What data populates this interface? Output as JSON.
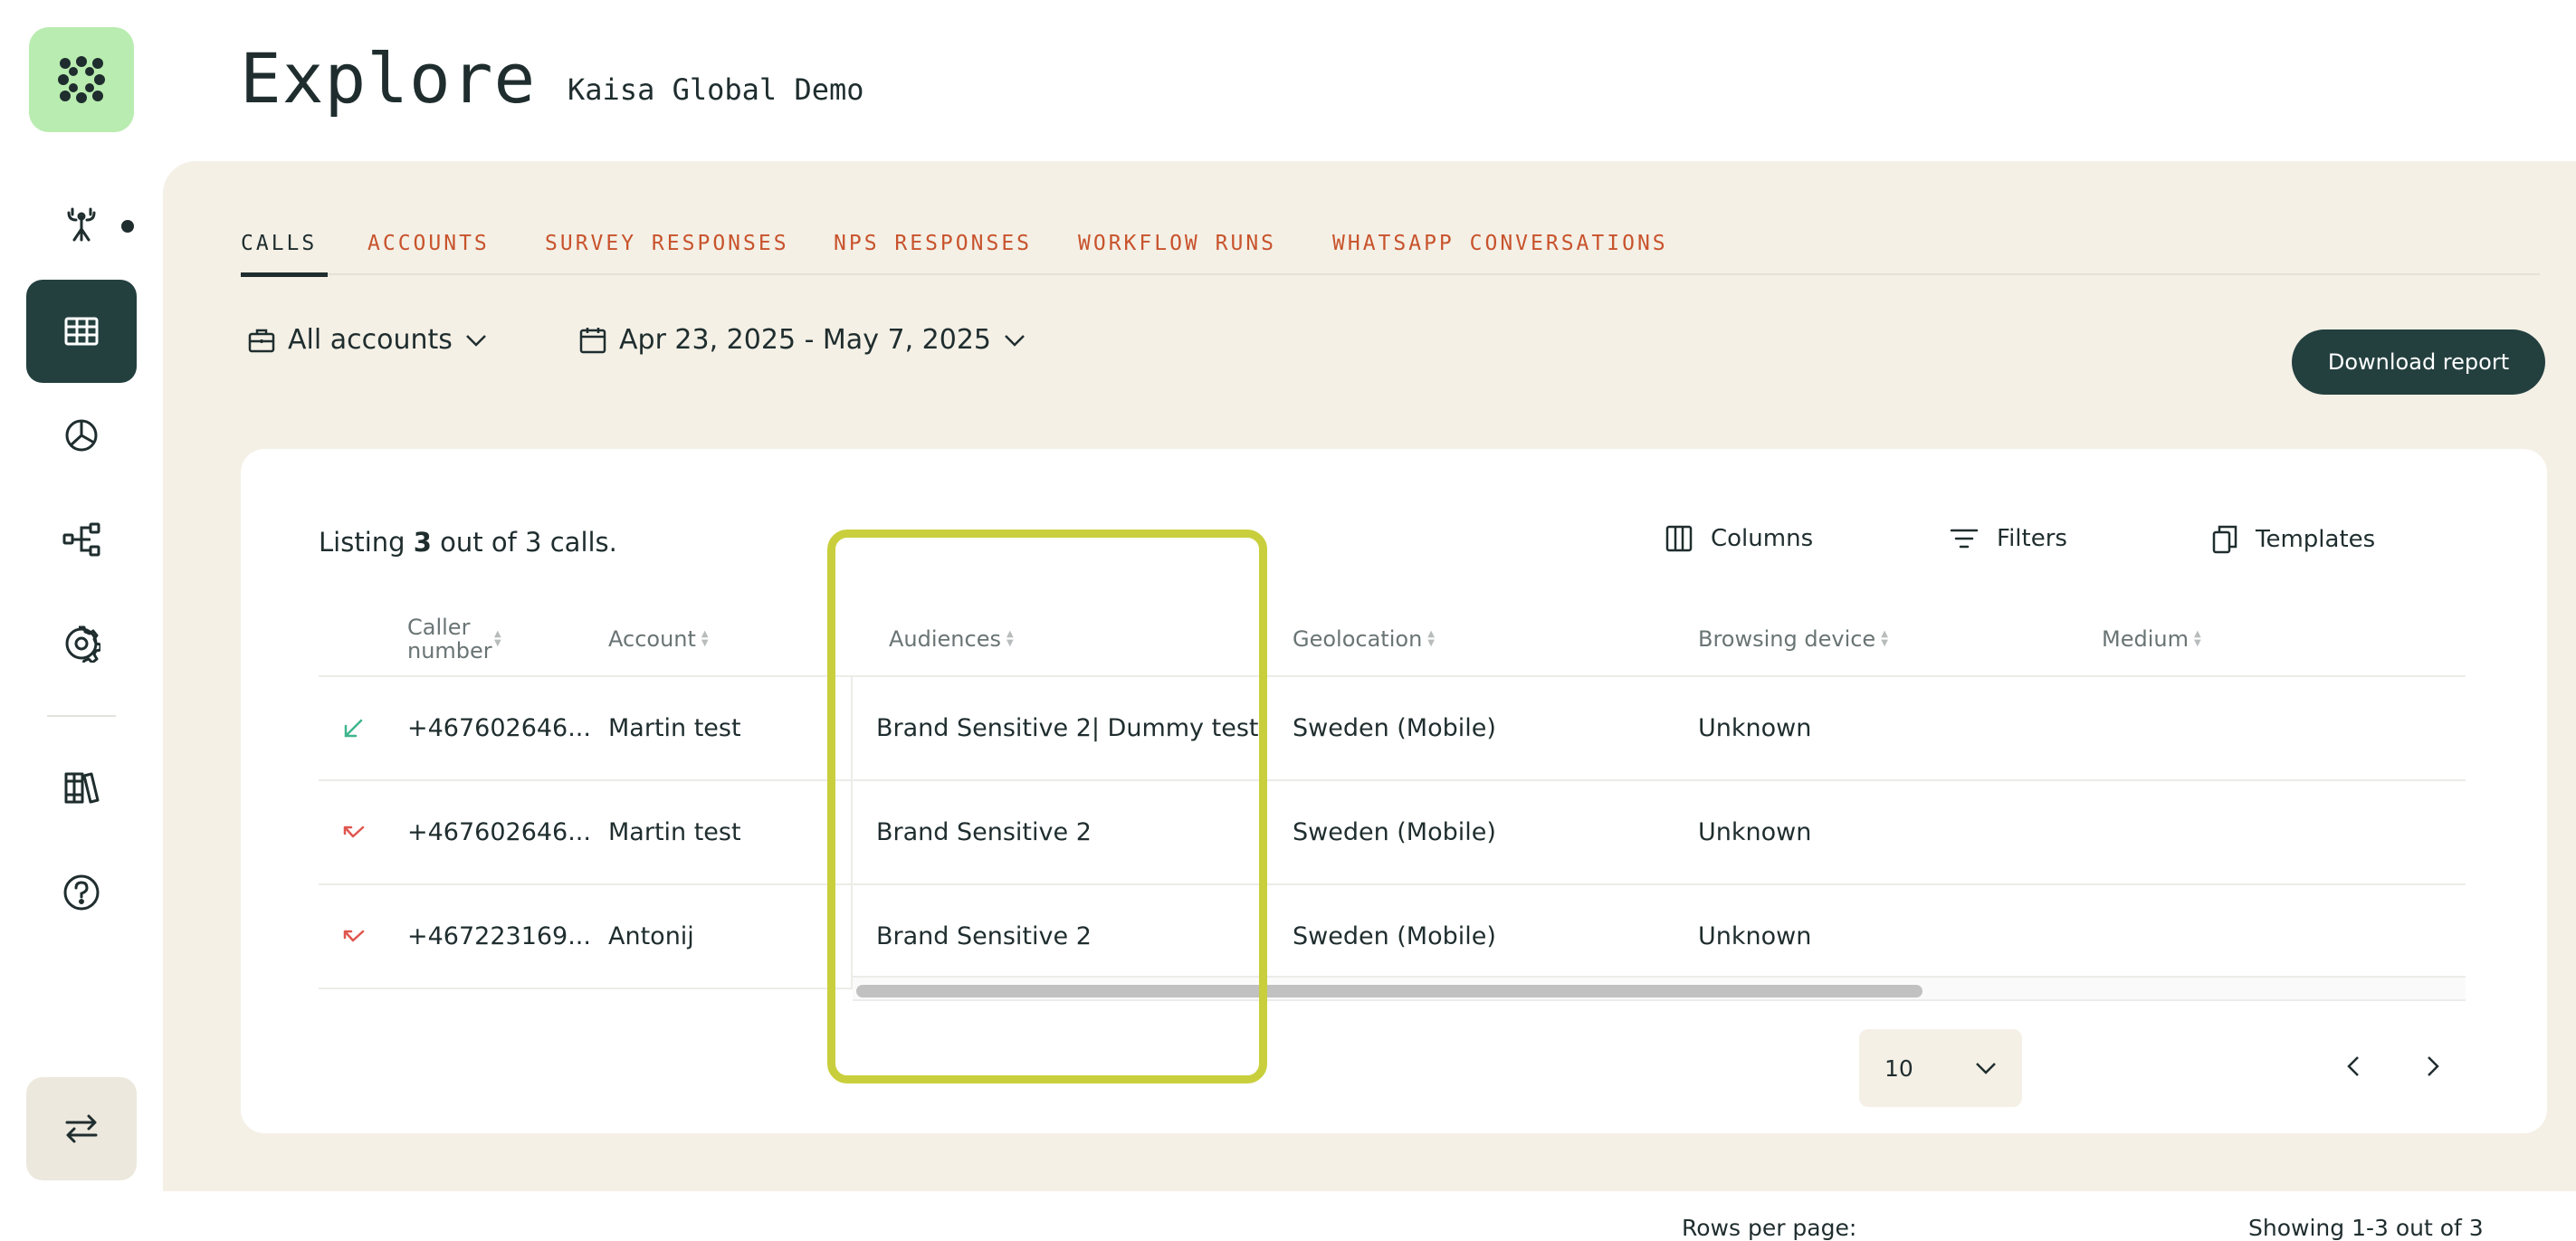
{
  "header": {
    "title": "Explore",
    "subtitle": "Kaisa Global Demo"
  },
  "tabs": [
    {
      "label": "CALLS",
      "active": true
    },
    {
      "label": "ACCOUNTS",
      "active": false
    },
    {
      "label": "SURVEY RESPONSES",
      "active": false
    },
    {
      "label": "NPS RESPONSES",
      "active": false
    },
    {
      "label": "WORKFLOW RUNS",
      "active": false
    },
    {
      "label": "WHATSAPP CONVERSATIONS",
      "active": false
    }
  ],
  "filters": {
    "accounts": "All accounts",
    "date_range": "Apr 23, 2025 - May 7, 2025"
  },
  "download_label": "Download report",
  "listing": {
    "prefix": "Listing",
    "count": "3",
    "suffix": "out of 3 calls."
  },
  "tools": {
    "columns": "Columns",
    "filters": "Filters",
    "templates": "Templates"
  },
  "columns": [
    "Caller number",
    "Account",
    "Audiences",
    "Geolocation",
    "Browsing device",
    "Medium"
  ],
  "rows": [
    {
      "direction": "incoming",
      "caller": "+467602646...",
      "account": "Martin test",
      "audiences": "Brand Sensitive 2| Dummy test",
      "geo": "Sweden (Mobile)",
      "device": "Unknown",
      "medium": ""
    },
    {
      "direction": "missed",
      "caller": "+467602646...",
      "account": "Martin test",
      "audiences": "Brand Sensitive 2",
      "geo": "Sweden (Mobile)",
      "device": "Unknown",
      "medium": ""
    },
    {
      "direction": "missed",
      "caller": "+467223169...",
      "account": "Antonij",
      "audiences": "Brand Sensitive 2",
      "geo": "Sweden (Mobile)",
      "device": "Unknown",
      "medium": ""
    }
  ],
  "pagination": {
    "rows_per_page_label": "Rows per page:",
    "rows_per_page": "10",
    "showing": "Showing 1-3 out of 3"
  },
  "colors": {
    "accent_dark": "#23403f",
    "tab_orange": "#c8532c",
    "panel_beige": "#f4f0e6",
    "logo_green": "#b9ecb0",
    "highlight": "#c9cf3c",
    "incoming_arrow": "#3fb58e",
    "missed_arrow": "#e0564f"
  },
  "icons": [
    "logo-icon",
    "antenna-icon",
    "table-icon",
    "pie-chart-icon",
    "workflow-icon",
    "gear-icon",
    "library-icon",
    "help-icon",
    "switch-arrows-icon",
    "briefcase-icon",
    "calendar-icon",
    "columns-icon",
    "filter-icon",
    "copy-icon",
    "chevron-down-icon",
    "chevron-left-icon",
    "chevron-right-icon"
  ]
}
